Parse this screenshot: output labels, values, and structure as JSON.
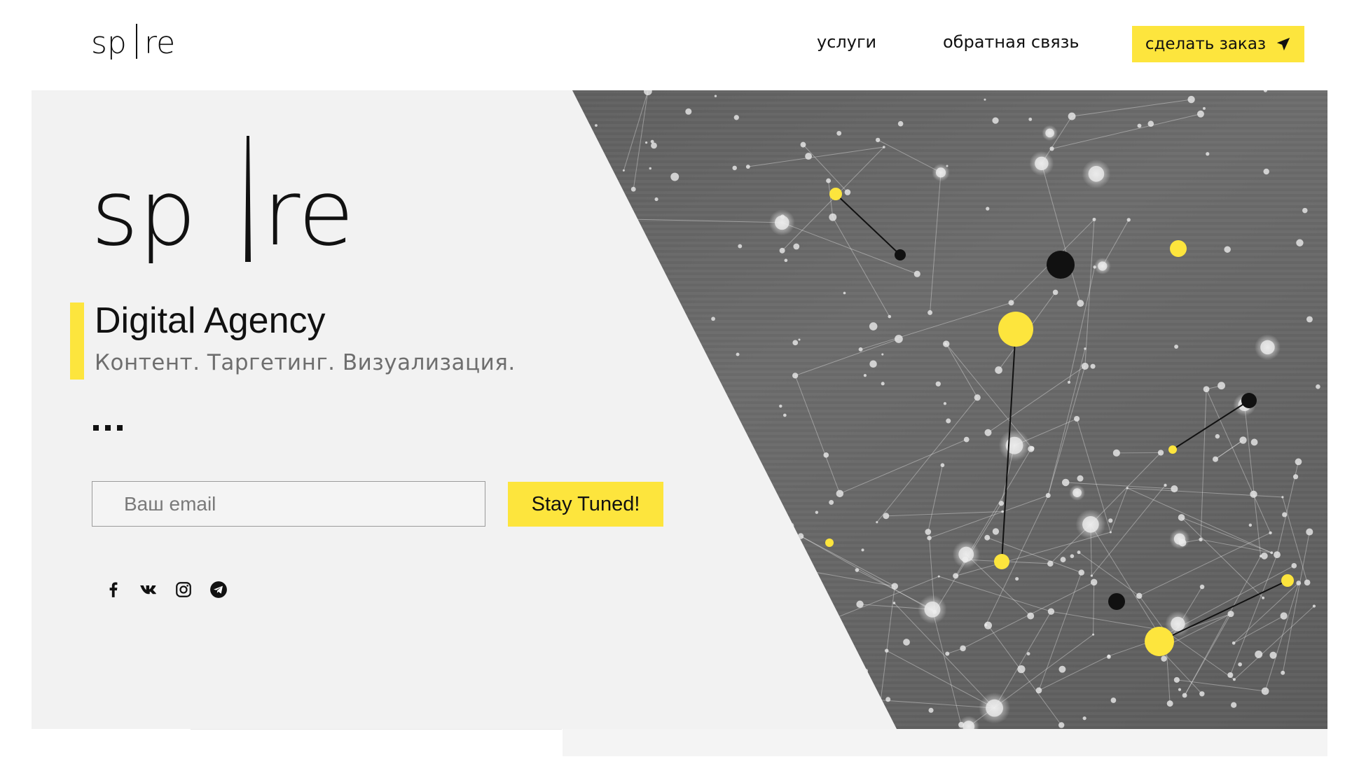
{
  "brand": {
    "logo_text": "spire"
  },
  "nav": {
    "services": "услуги",
    "feedback": "обратная связь",
    "order_button": "сделать заказ"
  },
  "hero": {
    "title": "Digital Agency",
    "subtitle": "Контент. Таргетинг. Визуализация.",
    "email_placeholder": "Ваш email",
    "subscribe_button": "Stay Tuned!",
    "social": [
      "facebook-icon",
      "vk-icon",
      "instagram-icon",
      "telegram-icon"
    ]
  },
  "colors": {
    "accent": "#fde53d",
    "hero_bg": "#f2f2f2",
    "text": "#111111",
    "subtitle": "#6e6e6e"
  }
}
